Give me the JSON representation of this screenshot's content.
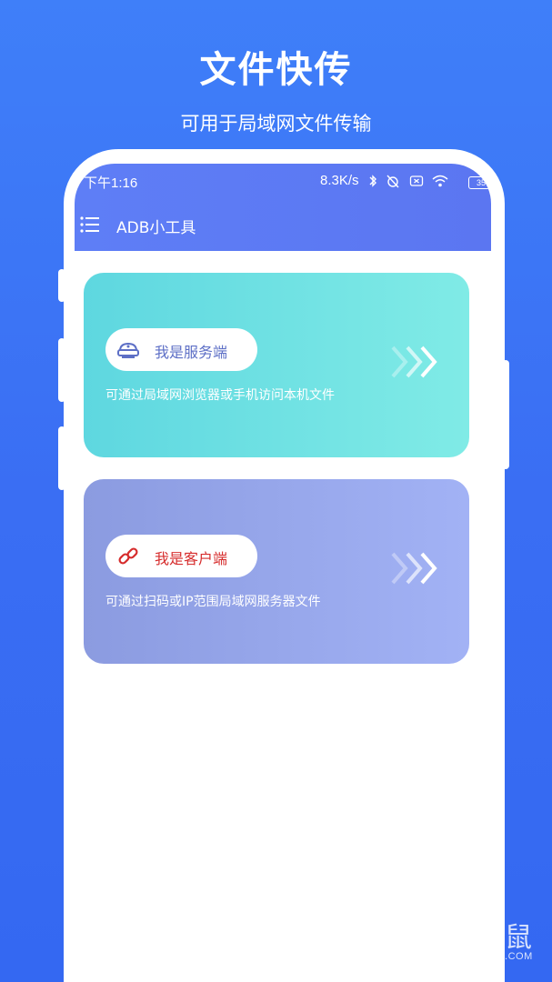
{
  "header": {
    "title": "文件快传",
    "subtitle": "可用于局域网文件传输"
  },
  "status_bar": {
    "time": "下午1:16",
    "network_speed": "8.3K/s",
    "battery": "35",
    "icons": [
      "bluetooth-icon",
      "alarm-off-icon",
      "sim-x-icon",
      "wifi-icon",
      "battery-icon"
    ]
  },
  "appbar": {
    "menu_icon": "menu-icon",
    "title": "ADB小工具"
  },
  "cards": [
    {
      "label": "我是服务端",
      "description": "可通过局域网浏览器或手机访问本机文件",
      "icon": "server-icon",
      "arrow_icon": "triple-chevron-right-icon"
    },
    {
      "label": "我是客户端",
      "description": "可通过扫码或IP范围局域网服务器文件",
      "icon": "link-icon",
      "arrow_icon": "triple-chevron-right-icon"
    }
  ],
  "watermark": {
    "text": "手机鼠",
    "sub": "SHOUJISHU.COM"
  },
  "colors": {
    "background": "#3a6ef3",
    "appbar": "#5e7ef6",
    "server_card": "#6be0e3",
    "client_card": "#97a7ea",
    "client_label": "#d62c2c"
  }
}
